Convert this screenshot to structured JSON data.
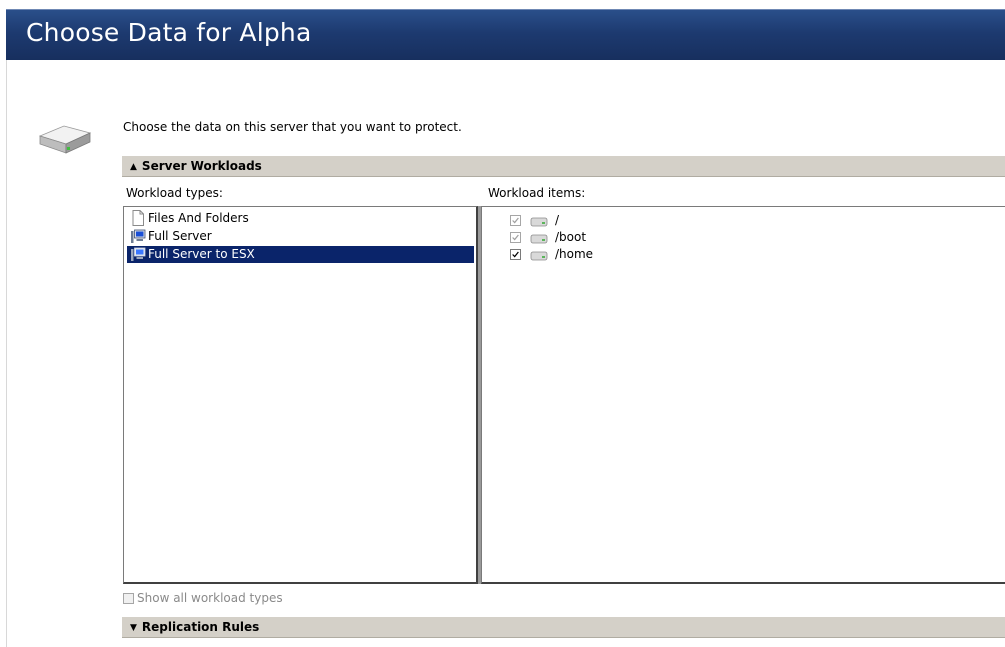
{
  "page": {
    "title": "Choose Data for Alpha"
  },
  "intro": {
    "text": "Choose the data on this server that you want to protect."
  },
  "sections": {
    "server_workloads": {
      "label": "Server Workloads",
      "arrow": "▲"
    },
    "replication_rules": {
      "label": "Replication Rules",
      "arrow": "▼"
    }
  },
  "workload_types": {
    "label": "Workload types:",
    "items": [
      {
        "label": "Files And Folders",
        "icon": "file-icon",
        "selected": false
      },
      {
        "label": "Full Server",
        "icon": "server-icon",
        "selected": false
      },
      {
        "label": "Full Server to ESX",
        "icon": "server-esx-icon",
        "selected": true
      }
    ]
  },
  "workload_items": {
    "label": "Workload items:",
    "items": [
      {
        "label": "/",
        "checked": true,
        "disabled": true
      },
      {
        "label": "/boot",
        "checked": true,
        "disabled": true
      },
      {
        "label": "/home",
        "checked": true,
        "disabled": false
      }
    ]
  },
  "show_all": {
    "label": "Show all workload types",
    "checked": false,
    "disabled": true
  },
  "colors": {
    "title_bar": "#1d3a70",
    "selection": "#0a246a",
    "section_header": "#d4d0c8"
  }
}
